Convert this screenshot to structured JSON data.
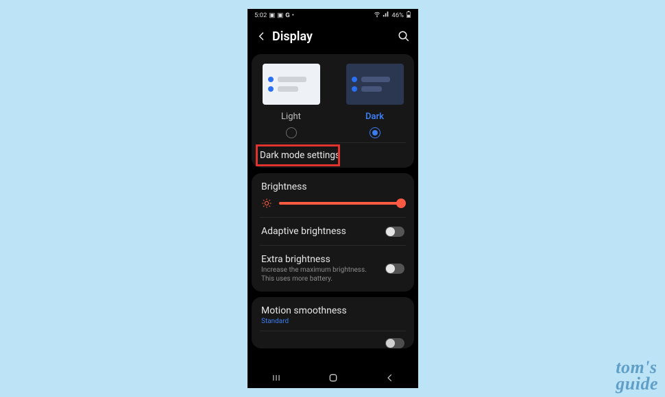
{
  "status": {
    "time": "5:02",
    "icons_left": [
      "image-icon",
      "image-icon",
      "google-icon",
      "dot-icon"
    ],
    "icons_right": [
      "wifi-icon",
      "signal-icon"
    ],
    "battery_text": "46%"
  },
  "header": {
    "title": "Display"
  },
  "theme": {
    "light": {
      "label": "Light",
      "selected": false
    },
    "dark": {
      "label": "Dark",
      "selected": true
    },
    "dark_mode_settings_label": "Dark mode settings"
  },
  "brightness": {
    "label": "Brightness",
    "value_percent": 95,
    "adaptive_label": "Adaptive brightness",
    "adaptive_on": false,
    "extra_label": "Extra brightness",
    "extra_desc": "Increase the maximum brightness. This uses more battery.",
    "extra_on": false
  },
  "motion": {
    "label": "Motion smoothness",
    "value": "Standard"
  },
  "watermark": {
    "line1": "tom's",
    "line2": "guide"
  }
}
